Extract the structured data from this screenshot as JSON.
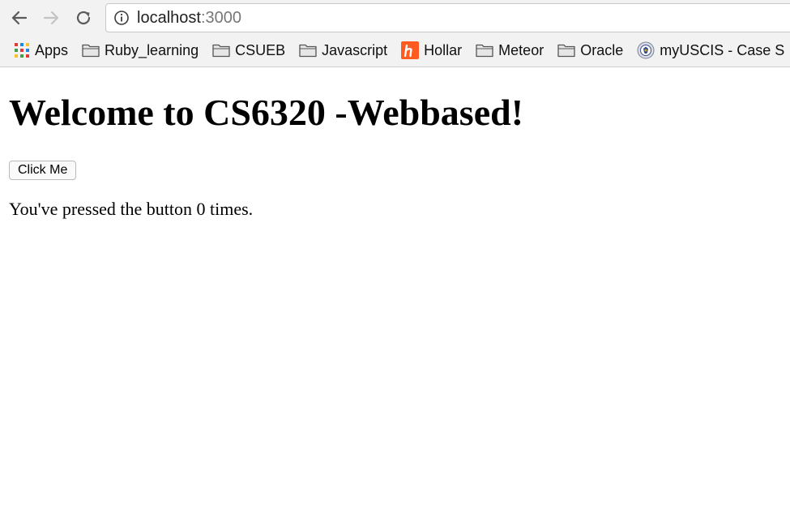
{
  "browser": {
    "url_host": "localhost",
    "url_port": ":3000",
    "bookmarks": [
      {
        "label": "Apps",
        "icon": "apps-grid-icon"
      },
      {
        "label": "Ruby_learning",
        "icon": "folder-icon"
      },
      {
        "label": "CSUEB",
        "icon": "folder-icon"
      },
      {
        "label": "Javascript",
        "icon": "folder-icon"
      },
      {
        "label": "Hollar",
        "icon": "hollar-logo-icon"
      },
      {
        "label": "Meteor",
        "icon": "folder-icon"
      },
      {
        "label": "Oracle",
        "icon": "folder-icon"
      },
      {
        "label": "myUSCIS - Case S",
        "icon": "dhs-seal-icon"
      }
    ],
    "colors": {
      "hollar_orange": "#ff5a1f",
      "chrome_background": "#f2f2f2"
    }
  },
  "page": {
    "title": "Welcome to CS6320 -Webbased!",
    "button_label": "Click Me",
    "counter_text": "You've pressed the button 0 times."
  }
}
